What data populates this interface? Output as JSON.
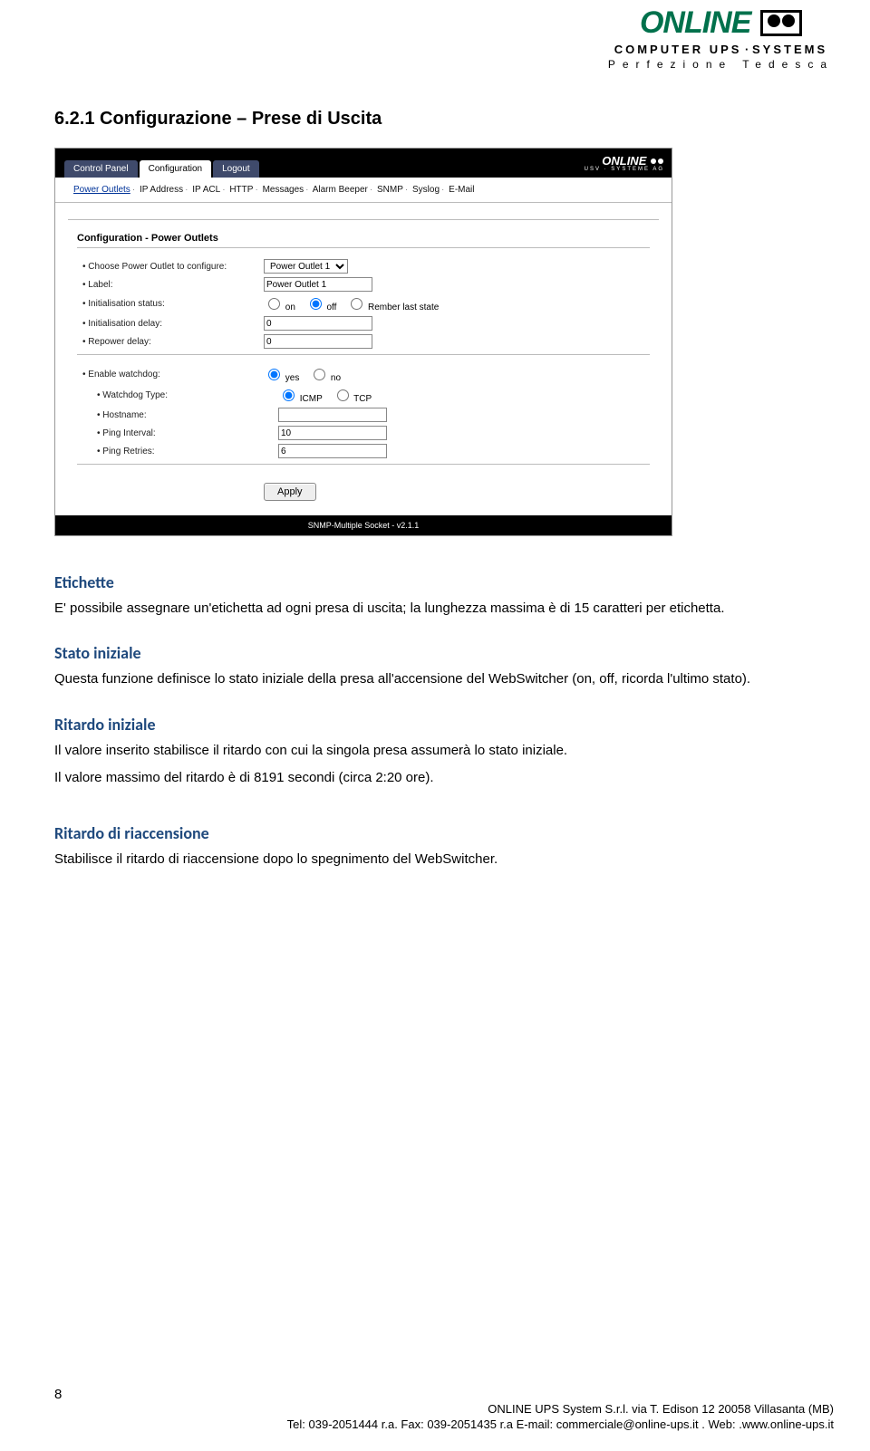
{
  "brand": {
    "logo_text": "ONLINE",
    "line1_left": "COMPUTER UPS",
    "line1_right": "SYSTEMS",
    "line2": "Perfezione  Tedesca"
  },
  "heading": "6.2.1 Configurazione – Prese di Uscita",
  "cfg": {
    "tabs": {
      "control": "Control Panel",
      "configuration": "Configuration",
      "logout": "Logout"
    },
    "brand_line1": "ONLINE",
    "brand_line2": "USV · SYSTEME  AG",
    "subnav": [
      "Power Outlets",
      "IP Address",
      "IP ACL",
      "HTTP",
      "Messages",
      "Alarm Beeper",
      "SNMP",
      "Syslog",
      "E-Mail"
    ],
    "panel_title": "Configuration - Power Outlets",
    "rows": {
      "choose_label": "Choose Power Outlet to configure:",
      "choose_value": "Power Outlet 1",
      "label_label": "Label:",
      "label_value": "Power Outlet 1",
      "init_status_label": "Initialisation status:",
      "init_status_opts": {
        "on": "on",
        "off": "off",
        "remember": "Rember last state"
      },
      "init_delay_label": "Initialisation delay:",
      "init_delay_value": "0",
      "repower_label": "Repower delay:",
      "repower_value": "0",
      "watchdog_label": "Enable watchdog:",
      "watchdog_opts": {
        "yes": "yes",
        "no": "no"
      },
      "wd_type_label": "Watchdog Type:",
      "wd_type_opts": {
        "icmp": "ICMP",
        "tcp": "TCP"
      },
      "hostname_label": "Hostname:",
      "ping_int_label": "Ping Interval:",
      "ping_int_value": "10",
      "ping_ret_label": "Ping Retries:",
      "ping_ret_value": "6"
    },
    "apply": "Apply",
    "footer": "SNMP-Multiple Socket - v2.1.1"
  },
  "sections": {
    "s1_title": "Etichette",
    "s1_body": "E' possibile assegnare un'etichetta ad ogni presa di uscita; la lunghezza massima è di 15 caratteri per etichetta.",
    "s2_title": "Stato iniziale",
    "s2_body": "Questa funzione definisce lo stato iniziale della presa all'accensione del WebSwitcher (on, off, ricorda l'ultimo stato).",
    "s3_title": "Ritardo iniziale",
    "s3_body1": "Il valore inserito stabilisce il ritardo con cui la singola presa assumerà lo stato iniziale.",
    "s3_body2": "Il valore massimo del ritardo è di 8191 secondi (circa 2:20 ore).",
    "s4_title": "Ritardo di riaccensione",
    "s4_body": "Stabilisce il ritardo di riaccensione dopo lo spegnimento del WebSwitcher."
  },
  "footer": {
    "page_num": "8",
    "line1": "ONLINE UPS System S.r.l.    via T. Edison 12  20058 Villasanta  (MB)",
    "line2": "Tel: 039-2051444 r.a.  Fax: 039-2051435 r.a  E-mail: commerciale@online-ups.it .  Web: .www.online-ups.it"
  }
}
